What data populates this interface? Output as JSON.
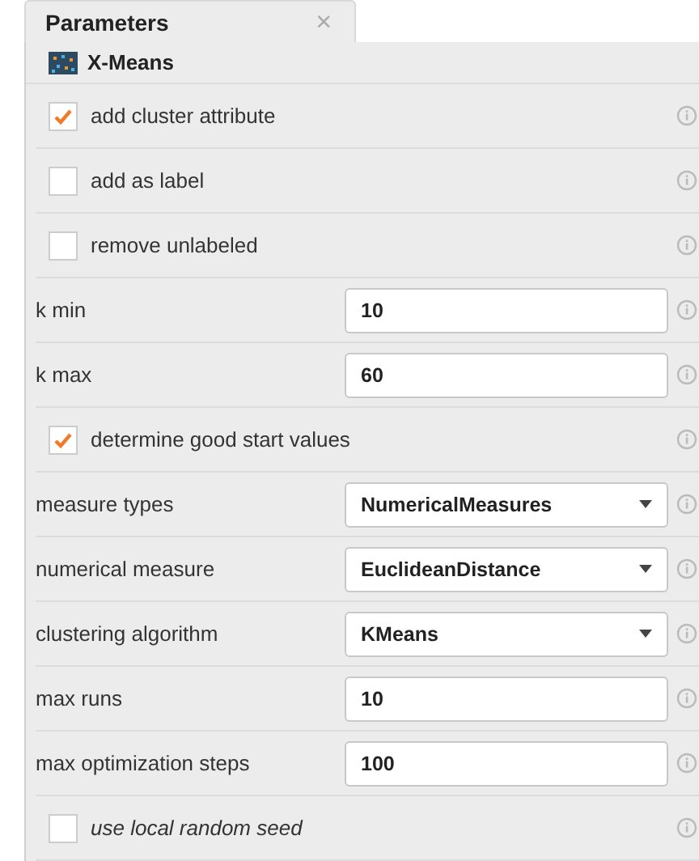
{
  "tab": {
    "label": "Parameters",
    "close": "×",
    "selected": true
  },
  "operator": {
    "name": "X-Means"
  },
  "parameters": [
    {
      "kind": "checkbox",
      "label": "add cluster attribute",
      "checked": true,
      "expert": false
    },
    {
      "kind": "checkbox",
      "label": "add as label",
      "checked": false,
      "expert": false
    },
    {
      "kind": "checkbox",
      "label": "remove unlabeled",
      "checked": false,
      "expert": false
    },
    {
      "kind": "text",
      "label": "k min",
      "value": "10",
      "expert": false
    },
    {
      "kind": "text",
      "label": "k max",
      "value": "60",
      "expert": false
    },
    {
      "kind": "checkbox",
      "label": "determine good start values",
      "checked": true,
      "expert": false
    },
    {
      "kind": "select",
      "label": "measure types",
      "value": "NumericalMeasures",
      "expert": false
    },
    {
      "kind": "select",
      "label": "numerical measure",
      "value": "EuclideanDistance",
      "expert": false
    },
    {
      "kind": "select",
      "label": "clustering algorithm",
      "value": "KMeans",
      "expert": false
    },
    {
      "kind": "text",
      "label": "max runs",
      "value": "10",
      "expert": false
    },
    {
      "kind": "text",
      "label": "max optimization steps",
      "value": "100",
      "expert": false
    },
    {
      "kind": "checkbox",
      "label": "use local random seed",
      "checked": false,
      "expert": true
    }
  ]
}
